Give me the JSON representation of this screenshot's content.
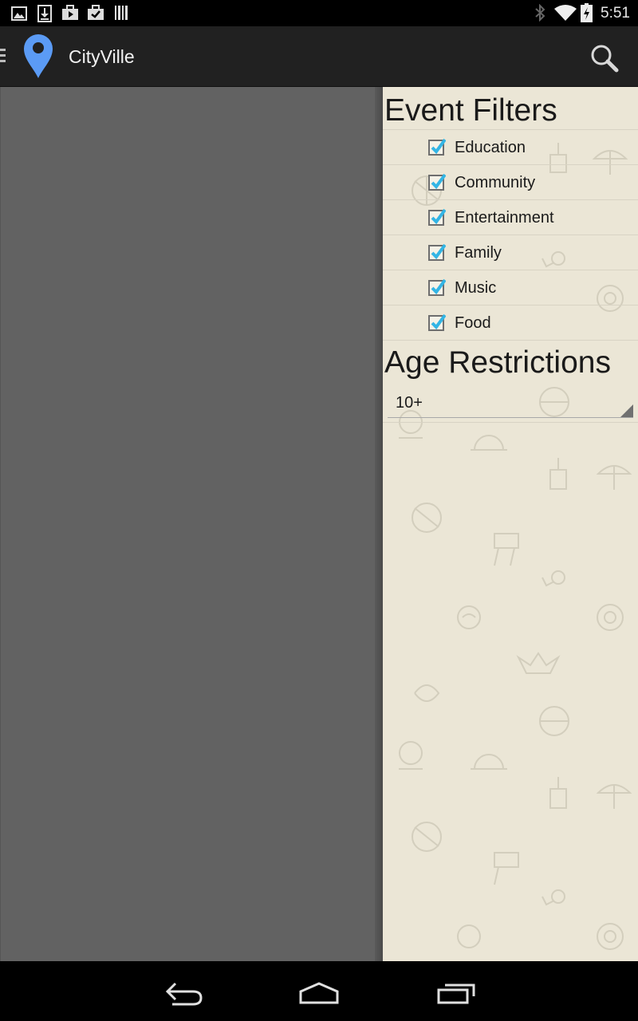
{
  "status_bar": {
    "time": "5:51",
    "left_icons": [
      "image-icon",
      "download-icon",
      "briefcase-play-icon",
      "briefcase-check-icon",
      "barcode-icon"
    ],
    "right_icons": [
      "bluetooth-icon",
      "wifi-icon",
      "battery-charging-icon"
    ]
  },
  "action_bar": {
    "title": "CityVille",
    "logo_icon": "map-pin-icon",
    "accent": "#5b9bf5"
  },
  "drawer": {
    "filters_title": "Event Filters",
    "filters": [
      {
        "label": "Education",
        "checked": true
      },
      {
        "label": "Community",
        "checked": true
      },
      {
        "label": "Entertainment",
        "checked": true
      },
      {
        "label": "Family",
        "checked": true
      },
      {
        "label": "Music",
        "checked": true
      },
      {
        "label": "Food",
        "checked": true
      }
    ],
    "age_title": "Age Restrictions",
    "age_selected": "10+",
    "check_color": "#33b5e5",
    "background": "#ebe6d6"
  },
  "nav_bar": {
    "icons": [
      "back-icon",
      "home-icon",
      "recent-apps-icon"
    ]
  }
}
